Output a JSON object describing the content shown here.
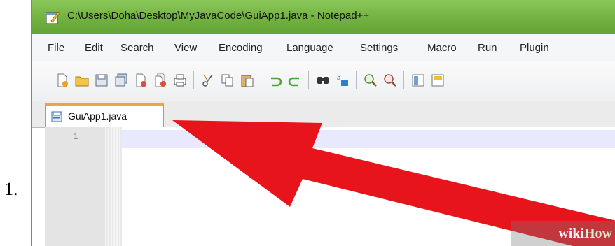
{
  "step": {
    "number": "1."
  },
  "window": {
    "title": "C:\\Users\\Doha\\Desktop\\MyJavaCode\\GuiApp1.java - Notepad++",
    "icon": "notepadpp-icon"
  },
  "menu": {
    "items": [
      "File",
      "Edit",
      "Search",
      "View",
      "Encoding",
      "Language",
      "Settings",
      "Macro",
      "Run",
      "Plugin"
    ]
  },
  "toolbar": {
    "buttons": [
      "new-file-icon",
      "open-file-icon",
      "save-icon",
      "save-all-icon",
      "close-icon",
      "close-all-icon",
      "print-icon",
      "cut-icon",
      "copy-icon",
      "paste-icon",
      "undo-icon",
      "redo-icon",
      "find-icon",
      "replace-icon",
      "zoom-in-icon",
      "zoom-out-icon",
      "sync-scroll-icon",
      "wrap-icon"
    ]
  },
  "tab": {
    "label": "GuiApp1.java"
  },
  "editor": {
    "line_number": "1"
  },
  "watermark": {
    "part1": "wiki",
    "part2": "How"
  },
  "colors": {
    "titlebar": "#71b240",
    "arrow": "#e8141b",
    "tab_accent": "#f2a14a",
    "current_line": "#e8e8ff"
  }
}
